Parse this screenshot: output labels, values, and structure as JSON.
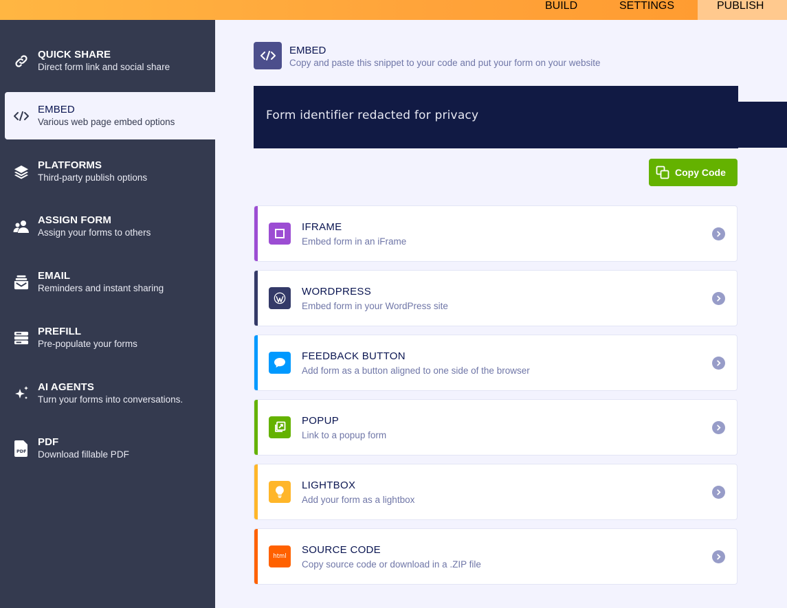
{
  "topnav": {
    "build": "BUILD",
    "settings": "SETTINGS",
    "publish": "PUBLISH"
  },
  "sidebar": {
    "items": [
      {
        "icon": "link-icon",
        "title": "QUICK SHARE",
        "subtitle": "Direct form link and social share"
      },
      {
        "icon": "code-icon",
        "title": "EMBED",
        "subtitle": "Various web page embed options"
      },
      {
        "icon": "layers-icon",
        "title": "PLATFORMS",
        "subtitle": "Third-party publish options"
      },
      {
        "icon": "users-icon",
        "title": "ASSIGN FORM",
        "subtitle": "Assign your forms to others"
      },
      {
        "icon": "email-icon",
        "title": "EMAIL",
        "subtitle": "Reminders and instant sharing"
      },
      {
        "icon": "prefill-icon",
        "title": "PREFILL",
        "subtitle": "Pre-populate your forms"
      },
      {
        "icon": "sparkles-icon",
        "title": "AI AGENTS",
        "subtitle": "Turn your forms into conversations."
      },
      {
        "icon": "pdf-icon",
        "title": "PDF",
        "subtitle": "Download fillable PDF"
      }
    ]
  },
  "embed": {
    "title": "EMBED",
    "subtitle": "Copy and paste this snippet to your code and put your form on your website",
    "code_text": "Form identifier redacted for privacy",
    "copy_label": "Copy Code"
  },
  "options": [
    {
      "title": "IFRAME",
      "subtitle": "Embed form in an iFrame",
      "color": "#9c4dd3",
      "icon": "iframe-icon"
    },
    {
      "title": "WORDPRESS",
      "subtitle": "Embed form in your WordPress site",
      "color": "#343a68",
      "icon": "wordpress-icon"
    },
    {
      "title": "FEEDBACK BUTTON",
      "subtitle": "Add form as a button aligned to one side of the browser",
      "color": "#0099ff",
      "icon": "chat-bubble-icon"
    },
    {
      "title": "POPUP",
      "subtitle": "Link to a popup form",
      "color": "#64b200",
      "icon": "popup-icon"
    },
    {
      "title": "LIGHTBOX",
      "subtitle": "Add your form as a lightbox",
      "color": "#ffb629",
      "icon": "lightbulb-icon"
    },
    {
      "title": "SOURCE CODE",
      "subtitle": "Copy source code or download in a .ZIP file",
      "color": "#ff6100",
      "icon": "html-icon",
      "icon_text": "html"
    }
  ]
}
